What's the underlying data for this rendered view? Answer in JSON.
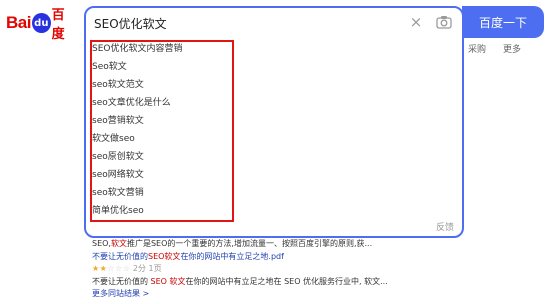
{
  "logo": {
    "text_bai": "Bai",
    "text_paw": "du",
    "text_du": "百度"
  },
  "search": {
    "value": "SEO优化软文",
    "button_label": "百度一下",
    "clear_glyph": "×",
    "camera_icon": "camera-icon"
  },
  "suggestions": [
    "SEO优化软文内容营销",
    "Seo软文",
    "seo软文范文",
    "seo文章优化是什么",
    "seo营销软文",
    "软文做seo",
    "seo原创软文",
    "seo网络软文",
    "seo软文营销",
    "简单优化seo"
  ],
  "feedback_label": "反馈",
  "nav": {
    "item1": "采购",
    "item2": "更多"
  },
  "results": {
    "line1_pre": "SEO,",
    "line1_hl": "软文",
    "line1_post": "推广是SEO的一个重要的方法,增加流量一、按照百度引擎的原则,获...",
    "title_pre": "不要让无价值的",
    "title_hl": "SEO软文",
    "title_post": "在你的网站中有立足之地.pdf",
    "stars": "★★",
    "stars_off": "☆☆☆",
    "meta_score": "2分",
    "meta_pages": "1页",
    "snippet_pre": "不要让无价值的 ",
    "snippet_hl1": "SEO",
    "snippet_mid": " ",
    "snippet_hl2": "软文",
    "snippet_post": "在你的网站中有立足之地在 SEO 优化服务行业中, 软文...",
    "more_link": "更多同站结果 >"
  }
}
